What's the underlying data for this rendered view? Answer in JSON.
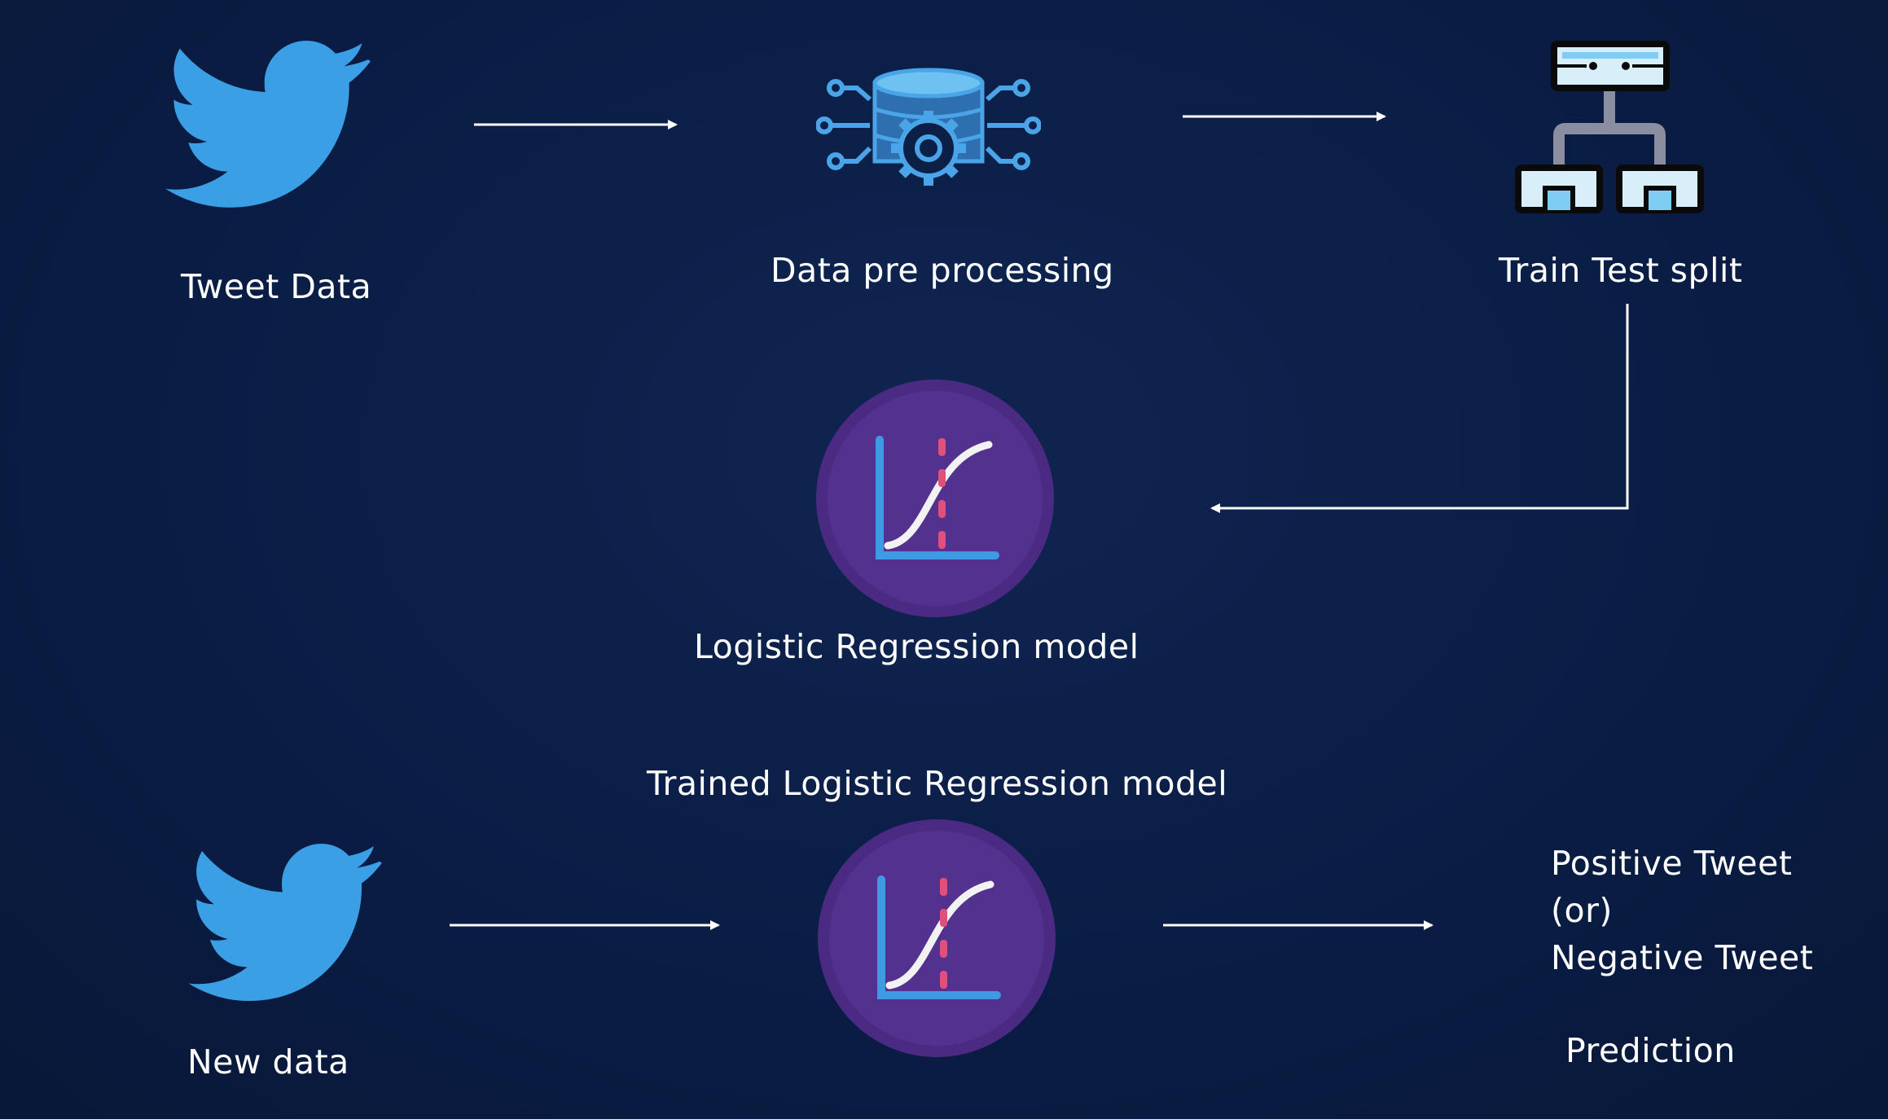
{
  "nodes": {
    "tweet_data": {
      "label": "Tweet Data",
      "icon": "twitter-bird-icon"
    },
    "preprocessing": {
      "label": "Data pre processing",
      "icon": "database-gear-icon"
    },
    "train_test_split": {
      "label": "Train Test split",
      "icon": "split-hierarchy-icon"
    },
    "lr_model": {
      "label": "Logistic Regression model",
      "icon": "logistic-curve-icon"
    },
    "trained_model": {
      "label": "Trained Logistic Regression model",
      "icon": "logistic-curve-icon"
    },
    "new_data": {
      "label": "New data",
      "icon": "twitter-bird-icon"
    },
    "output": {
      "line1": "Positive Tweet",
      "line2": "(or)",
      "line3": "Negative Tweet",
      "caption": "Prediction"
    }
  },
  "colors": {
    "background": "#0b1f47",
    "twitter_blue": "#3b9fe6",
    "model_circle": "#4a2a82",
    "curve_axis": "#3e9be3",
    "curve_marks": "#e0507a",
    "split_icon_fill": "#d8eef8",
    "split_icon_stroke": "#0a0a0a",
    "split_icon_connector": "#8b8ea0"
  }
}
